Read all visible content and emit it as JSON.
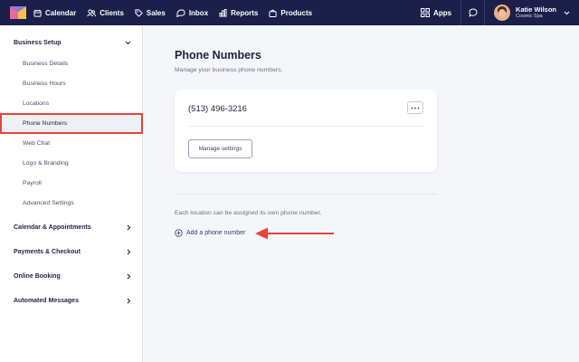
{
  "nav": {
    "items": [
      {
        "label": "Calendar",
        "icon": "calendar-icon"
      },
      {
        "label": "Clients",
        "icon": "clients-icon"
      },
      {
        "label": "Sales",
        "icon": "tag-icon"
      },
      {
        "label": "Inbox",
        "icon": "inbox-icon"
      },
      {
        "label": "Reports",
        "icon": "bar-chart-icon"
      },
      {
        "label": "Products",
        "icon": "bag-icon"
      }
    ],
    "apps_label": "Apps",
    "user_name": "Katie Wilson",
    "user_org": "Cosmic Spa"
  },
  "sidebar": {
    "business_setup": "Business Setup",
    "items": [
      "Business Details",
      "Business Hours",
      "Locations",
      "Phone Numbers",
      "Web Chat",
      "Logo & Branding",
      "Payroll",
      "Advanced Settings"
    ],
    "sections": [
      "Calendar & Appointments",
      "Payments & Checkout",
      "Online Booking",
      "Automated Messages"
    ]
  },
  "main": {
    "title": "Phone Numbers",
    "subtitle": "Manage your business phone numbers.",
    "phone_number": "(513) 496-3216",
    "manage_label": "Manage settings",
    "location_note": "Each location can be assigned its own phone number.",
    "add_label": "Add a phone number"
  },
  "colors": {
    "nav_bg": "#1c1f4a",
    "highlight": "#e8433a",
    "logo_pink": "#e56b9b",
    "logo_yellow": "#f3c24f"
  }
}
